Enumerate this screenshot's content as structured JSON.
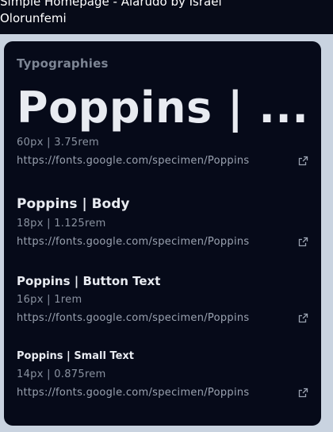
{
  "header": {
    "title": "Simple Homepage - Alarudo by Israel Olorunfemi"
  },
  "typography": {
    "section_label": "Typographies",
    "samples": [
      {
        "title": "Poppins | ...",
        "size": "60px | 3.75rem",
        "link": "https://fonts.google.com/specimen/Poppins",
        "link_icon": "external-link-icon"
      },
      {
        "title": "Poppins | Body",
        "size": "18px | 1.125rem",
        "link": "https://fonts.google.com/specimen/Poppins",
        "link_icon": "external-link-icon"
      },
      {
        "title": "Poppins | Button Text",
        "size": "16px | 1rem",
        "link": "https://fonts.google.com/specimen/Poppins",
        "link_icon": "external-link-icon"
      },
      {
        "title": "Poppins | Small Text",
        "size": "14px | 0.875rem",
        "link": "https://fonts.google.com/specimen/Poppins",
        "link_icon": "external-link-icon"
      }
    ]
  },
  "colors": {
    "page_background": "#c9d3e0",
    "card_background": "#060a19",
    "title_text": "#e8ebf1",
    "muted_text": "#8a92a0"
  }
}
